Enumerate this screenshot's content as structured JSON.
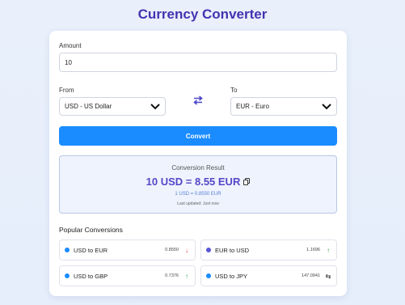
{
  "app": {
    "title": "Currency Converter"
  },
  "form": {
    "amount_label": "Amount",
    "amount_value": "10",
    "from_label": "From",
    "from_value": "USD - US Dollar",
    "to_label": "To",
    "to_value": "EUR - Euro",
    "convert_label": "Convert"
  },
  "result": {
    "title": "Conversion Result",
    "main": "10 USD = 8.55 EUR",
    "rate": "1 USD = 0.8550 EUR",
    "updated": "Last updated: Just now"
  },
  "popular": {
    "title": "Popular Conversions",
    "items": [
      {
        "label": "USD to EUR",
        "rate": "0.8550",
        "trend": "down",
        "trend_icon": "↓",
        "dot_color": "#1a8cff",
        "trend_color": "#e53935"
      },
      {
        "label": "EUR to USD",
        "rate": "1.1696",
        "trend": "up",
        "trend_icon": "↑",
        "dot_color": "#5b55d6",
        "trend_color": "#2e9e4a"
      },
      {
        "label": "USD to GBP",
        "rate": "0.7376",
        "trend": "up",
        "trend_icon": "↑",
        "dot_color": "#1a8cff",
        "trend_color": "#2e9e4a"
      },
      {
        "label": "USD to JPY",
        "rate": "147.0941",
        "trend": "neutral",
        "trend_icon": "⇆",
        "dot_color": "#1a8cff",
        "trend_color": "#555555"
      }
    ]
  },
  "colors": {
    "accent": "#1a8cff",
    "title": "#4433b0",
    "result_bg": "#eef3fd",
    "result_text": "#5546c8"
  }
}
